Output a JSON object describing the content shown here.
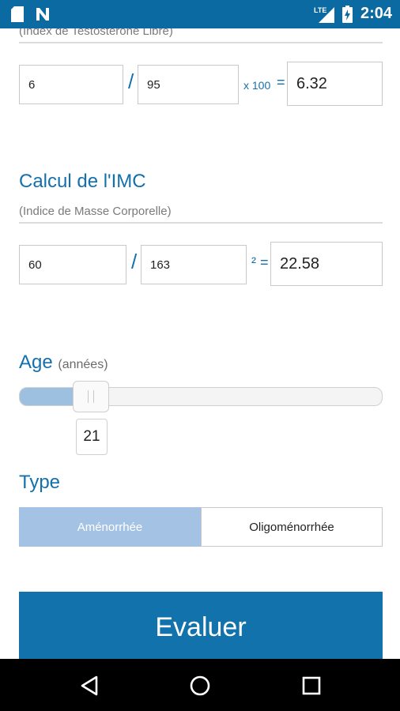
{
  "status_bar": {
    "time": "2:04",
    "network": "LTE",
    "icons": [
      "sd-card-icon",
      "notification-n-icon",
      "lte-signal-icon",
      "battery-charging-icon"
    ]
  },
  "ftl": {
    "subtitle": "(Index de Testosterone Libre)",
    "numerator": "6",
    "denominator": "95",
    "multiplier": "x 100",
    "equals": "=",
    "result": "6.32",
    "slash": "/"
  },
  "imc": {
    "title": "Calcul de l'IMC",
    "subtitle": "(Indice de Masse Corporelle)",
    "weight": "60",
    "height": "163",
    "squared_equals": "² =",
    "result": "22.58",
    "slash": "/"
  },
  "age": {
    "title": "Age",
    "unit": "(années)",
    "value": "21"
  },
  "type": {
    "title": "Type",
    "options": [
      "Aménorrhée",
      "Oligoménorrhée"
    ],
    "selected": "Aménorrhée"
  },
  "evaluate_button": {
    "label": "Evaluer"
  },
  "colors": {
    "accent": "#1470ad",
    "status_bar": "#0a6aa1",
    "button": "#1172ac",
    "selected_segment": "#a4c2e3"
  },
  "nav_icons": [
    "back-triangle-icon",
    "home-circle-icon",
    "recents-square-icon"
  ]
}
